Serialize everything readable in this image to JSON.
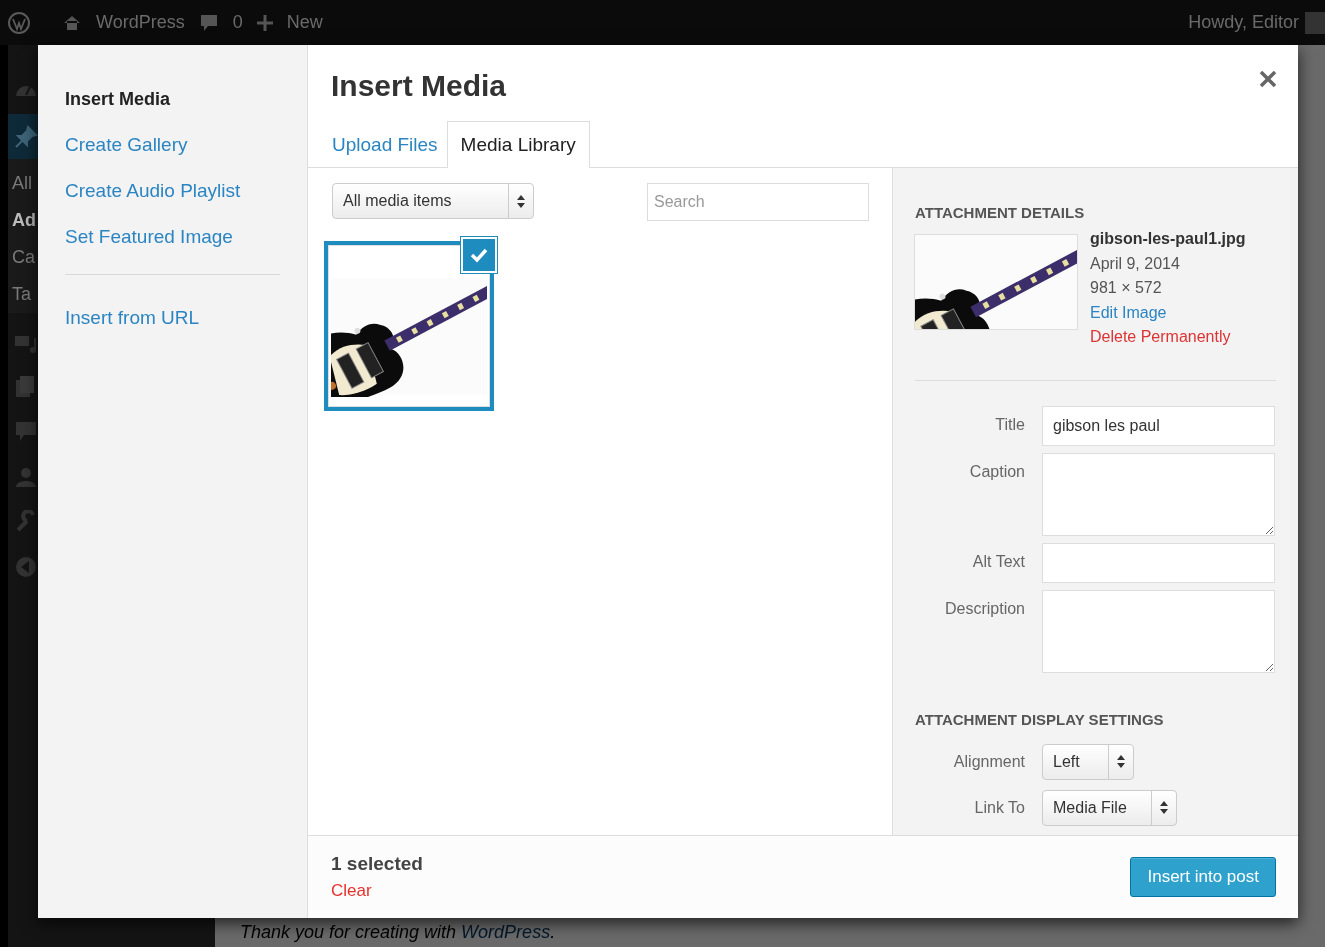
{
  "admin_bar": {
    "site": "WordPress",
    "comments": "0",
    "new": "New",
    "greeting": "Howdy, Editor"
  },
  "admin_menu": [
    {
      "label": "All",
      "selected": false
    },
    {
      "label": "Ad",
      "selected": true
    },
    {
      "label": "Ca",
      "selected": false
    },
    {
      "label": "Ta",
      "selected": false
    }
  ],
  "footer": {
    "text": "Thank you for creating with",
    "link": "WordPress",
    "end": "."
  },
  "modal": {
    "menu_groups": [
      [
        {
          "label": "Insert Media",
          "selected": true
        },
        {
          "label": "Create Gallery",
          "selected": false
        },
        {
          "label": "Create Audio Playlist",
          "selected": false
        },
        {
          "label": "Set Featured Image",
          "selected": false
        }
      ],
      [
        {
          "label": "Insert from URL",
          "selected": false
        }
      ]
    ],
    "title": "Insert Media",
    "tabs": [
      {
        "label": "Upload Files",
        "selected": false
      },
      {
        "label": "Media Library",
        "selected": true
      }
    ],
    "filter": {
      "value": "All media items"
    },
    "search": {
      "placeholder": "Search"
    },
    "attachments": [
      {
        "selected": true
      }
    ],
    "details": {
      "heading": "ATTACHMENT DETAILS",
      "filename": "gibson-les-paul1.jpg",
      "date": "April 9, 2014",
      "dimensions": "981 × 572",
      "edit_link": "Edit Image",
      "delete_link": "Delete Permanently",
      "fields": [
        {
          "label": "Title",
          "kind": "input",
          "value": "gibson les paul"
        },
        {
          "label": "Caption",
          "kind": "textarea"
        },
        {
          "label": "Alt Text",
          "kind": "input"
        },
        {
          "label": "Description",
          "kind": "textarea"
        }
      ]
    },
    "display_settings": {
      "heading": "ATTACHMENT DISPLAY SETTINGS",
      "settings": [
        {
          "label": "Alignment",
          "value": "Left"
        },
        {
          "label": "Link To",
          "value": "Media File"
        }
      ]
    },
    "toolbar": {
      "selection": "1 selected",
      "clear": "Clear",
      "insert_button": "Insert into post"
    }
  }
}
